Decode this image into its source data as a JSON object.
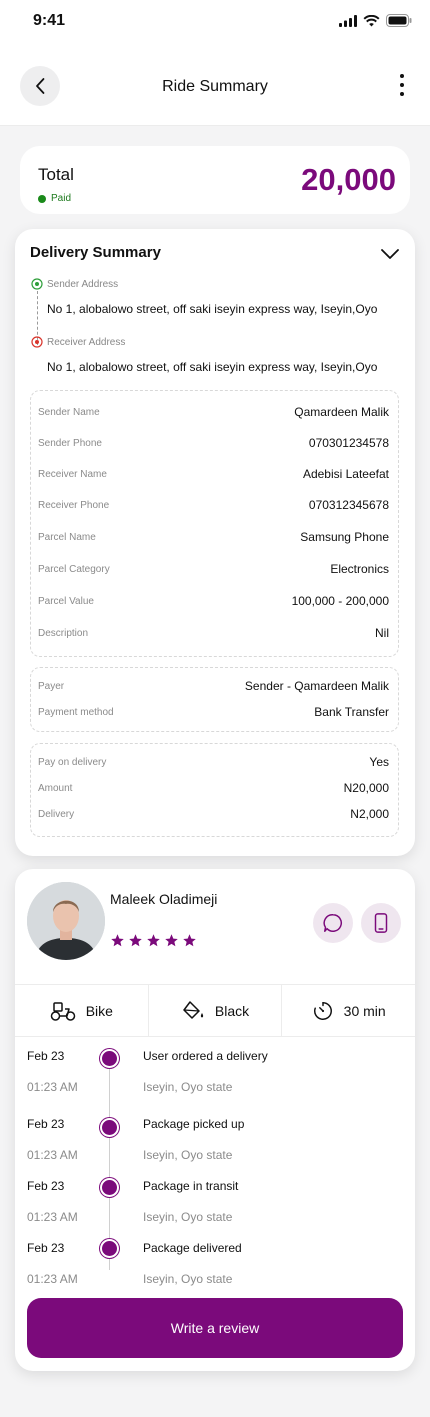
{
  "status_bar": {
    "time": "9:41"
  },
  "header": {
    "title": "Ride Summary"
  },
  "total": {
    "label": "Total",
    "status": "Paid",
    "amount": "20,000"
  },
  "delivery_summary": {
    "title": "Delivery Summary",
    "sender_address_label": "Sender Address",
    "sender_address": "No 1, alobalowo street, off saki iseyin express way, Iseyin,Oyo",
    "receiver_address_label": "Receiver Address",
    "receiver_address": "No 1, alobalowo street, off saki iseyin express way, Iseyin,Oyo",
    "details": [
      {
        "key": "Sender Name",
        "value": "Qamardeen Malik"
      },
      {
        "key": "Sender Phone",
        "value": "070301234578"
      },
      {
        "key": "Receiver Name",
        "value": "Adebisi Lateefat"
      },
      {
        "key": "Receiver Phone",
        "value": "070312345678"
      },
      {
        "key": "Parcel Name",
        "value": "Samsung Phone"
      },
      {
        "key": "Parcel Category",
        "value": "Electronics"
      },
      {
        "key": "Parcel Value",
        "value": "100,000 - 200,000"
      },
      {
        "key": "Description",
        "value": "Nil"
      }
    ],
    "payment": [
      {
        "key": "Payer",
        "value": "Sender - Qamardeen Malik"
      },
      {
        "key": "Payment method",
        "value": "Bank Transfer"
      }
    ],
    "charges": [
      {
        "key": "Pay on delivery",
        "value": "Yes"
      },
      {
        "key": "Amount",
        "value": "N20,000"
      },
      {
        "key": "Delivery",
        "value": "N2,000"
      }
    ]
  },
  "driver": {
    "name": "Maleek Oladimeji",
    "rating": 5,
    "vehicle": "Bike",
    "color": "Black",
    "duration": "30 min"
  },
  "timeline": [
    {
      "date": "Feb 23",
      "time": "01:23 AM",
      "title": "User ordered a delivery",
      "location": "Iseyin, Oyo state"
    },
    {
      "date": "Feb 23",
      "time": "01:23 AM",
      "title": "Package picked up",
      "location": "Iseyin, Oyo state"
    },
    {
      "date": "Feb 23",
      "time": "01:23 AM",
      "title": "Package in transit",
      "location": "Iseyin, Oyo state"
    },
    {
      "date": "Feb 23",
      "time": "01:23 AM",
      "title": "Package delivered",
      "location": "Iseyin, Oyo state"
    }
  ],
  "review_button": "Write a review",
  "colors": {
    "accent": "#7b0a7b",
    "paid": "#1a8a1a",
    "sender_pin": "#2e9e3a",
    "receiver_pin": "#d9342b"
  },
  "icons": [
    "back-arrow-icon",
    "more-vertical-icon",
    "chevron-down-icon",
    "chat-icon",
    "phone-icon",
    "bike-icon",
    "paint-bucket-icon",
    "timer-icon",
    "star-icon",
    "location-pin-icon",
    "signal-icon",
    "wifi-icon",
    "battery-icon"
  ]
}
